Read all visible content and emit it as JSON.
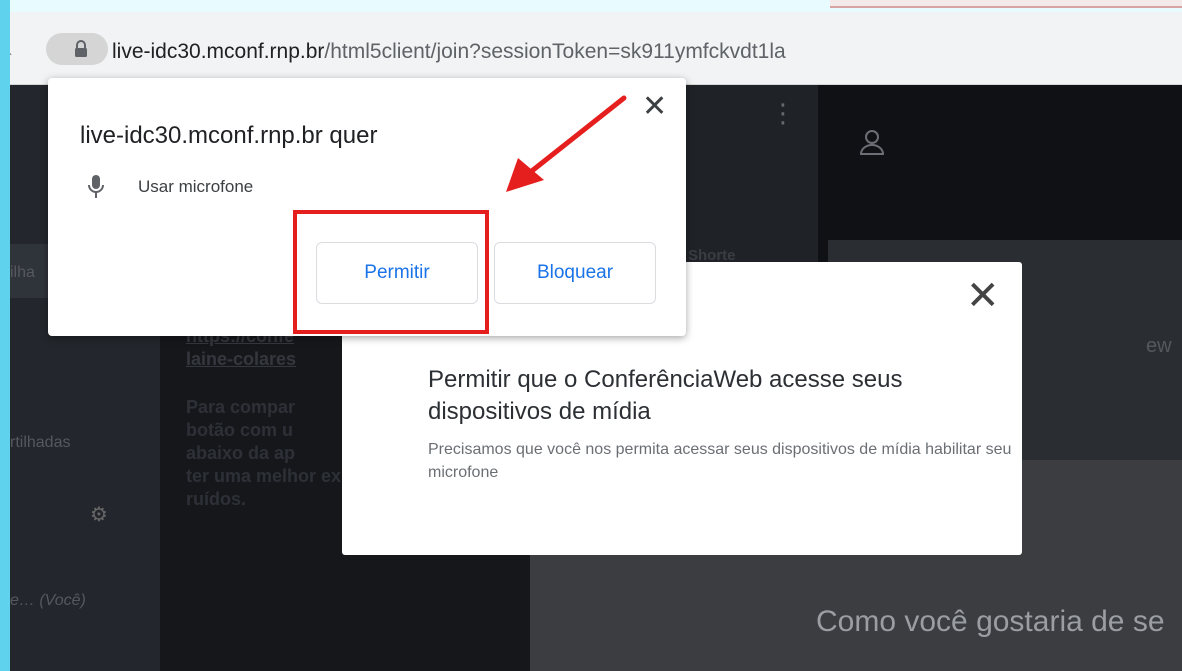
{
  "browser": {
    "url_host": "live-idc30.mconf.rnp.br",
    "url_path": "/html5client/join?sessionToken=sk911ymfckvdt1la"
  },
  "permission_prompt": {
    "title": "live-idc30.mconf.rnp.br quer",
    "permission_label": "Usar microfone",
    "allow_label": "Permitir",
    "block_label": "Bloquear",
    "close_glyph": "✕",
    "mic_icon": "microphone-icon"
  },
  "media_dialog": {
    "close_glyph": "✕",
    "title": "Permitir que o ConferênciaWeb acesse seus dispositivos de mídia",
    "description": "Precisamos que você nos permita acessar seus dispositivos de mídia habilitar seu microfone"
  },
  "background": {
    "left_labels": [
      "ilha",
      "rtilhadas",
      "e… (Você)"
    ],
    "mid_links": [
      "https://confe",
      "laine-colares"
    ],
    "mid_paragraph_lines": [
      "Para compar",
      "botão com u",
      "abaixo da ap",
      "ter uma melhor experiência c",
      "ruídos."
    ],
    "mid_header": "Shorte",
    "right_fragment": "ew",
    "bottom_prompt": "Como você gostaria de se"
  },
  "annotation": {
    "highlight_color": "#e51e1e"
  }
}
